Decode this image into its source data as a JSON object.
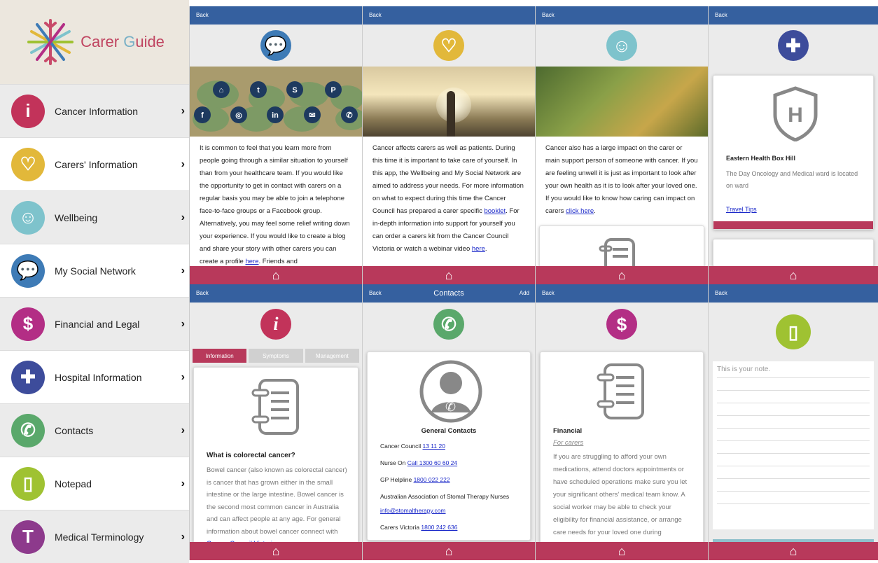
{
  "sidebar": {
    "brand": {
      "word1": "Carer ",
      "word2a": "G",
      "word2b": "uide"
    },
    "items": [
      {
        "label": "Cancer Information",
        "glyph": "i",
        "color": "#c2335a"
      },
      {
        "label": "Carers' Information",
        "glyph": "♡",
        "color": "#e2b83a"
      },
      {
        "label": "Wellbeing",
        "glyph": "☺",
        "color": "#7ec3cc"
      },
      {
        "label": "My Social Network",
        "glyph": "💬",
        "color": "#3e7bb6"
      },
      {
        "label": "Financial and Legal",
        "glyph": "$",
        "color": "#b32e85"
      },
      {
        "label": "Hospital Information",
        "glyph": "✚",
        "color": "#3d4c9b"
      },
      {
        "label": "Contacts",
        "glyph": "✆",
        "color": "#5aa86b"
      },
      {
        "label": "Notepad",
        "glyph": "▯",
        "color": "#9fc232"
      },
      {
        "label": "Medical Terminology",
        "glyph": "T",
        "color": "#8d3a8c"
      }
    ]
  },
  "common": {
    "back": "Back",
    "home": "⌂"
  },
  "p1": {
    "paras": [
      "It is common to feel that you learn more from people going through a similar situation to yourself than from your healthcare team. If you would like the opportunity to get in contact with carers on a regular basis you may be able to join a telephone face-to-face groups or a Facebook group. Alternatively, you may feel some relief writing down your experience. If you would like to create a blog and share your story with other carers you can create a profile ",
      "here",
      ". Friends and"
    ]
  },
  "p2": {
    "t1": "Cancer affects carers as well as patients. During this time it is important to take care of yourself. In this app, the Wellbeing and My Social Network are aimed to address your needs. For more information on what to expect during this time the Cancer Council has prepared a carer specific ",
    "link1": "booklet",
    "t2": ". For in-depth information into support for yourself you can order a carers kit from the Cancer Council Victoria or watch a webinar video ",
    "link2": "here",
    "t3": "."
  },
  "p3": {
    "t1": "Cancer also has a large impact on the carer or main support person of someone with cancer. If you are feeling unwell it is just as important to look after your own health as it is to look after your loved one. If you would like to know how caring can impact on carers ",
    "link": "click here",
    "t2": "."
  },
  "p4": {
    "title": "Eastern Health Box Hill",
    "body": "The Day Oncology and Medical ward is located on ward",
    "link": "Travel Tips"
  },
  "p5": {
    "tabs": [
      "Information",
      "Symptoms",
      "Management"
    ],
    "question": "What is colorectal cancer?",
    "body": "Bowel cancer (also known as colorectal cancer) is cancer that has grown either in the small intestine or the large intestine. Bowel cancer is the second most common cancer in Australia and can affect people at any age. For general information about bowel cancer connect with ",
    "link": "Cancer Council Victoria",
    "tail": " or"
  },
  "p6": {
    "title": "Contacts",
    "add": "Add",
    "heading": "General Contacts",
    "rows": [
      {
        "label": "Cancer Council ",
        "link": "13 11 20"
      },
      {
        "label": "Nurse On ",
        "link": "Call 1300 60 60 24"
      },
      {
        "label": "GP Helpline ",
        "link": "1800 022 222"
      },
      {
        "label": "Australian Association of Stomal Therapy Nurses",
        "link": ""
      },
      {
        "label": "",
        "link": "info@stomaltherapy.com"
      },
      {
        "label": "Carers Victoria ",
        "link": "1800 242 636"
      }
    ]
  },
  "p7": {
    "title": "Financial",
    "sub": "For carers",
    "body": "If you are struggling to afford your own medications, attend doctors appointments or have scheduled operations make sure you let your significant others' medical team know. A social worker may be able to check your eligibility for financial assistance, or arrange care needs for your loved one during"
  },
  "p8": {
    "placeholder": "This is your note."
  }
}
